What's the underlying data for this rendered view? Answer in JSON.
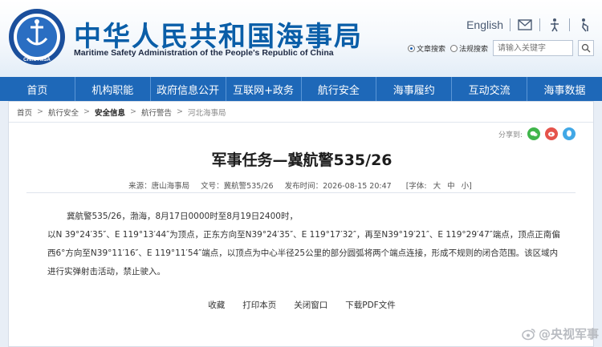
{
  "header": {
    "cn_title": "中华人民共和国海事局",
    "en_title": "Maritime Safety Administration of the People's Republic of China",
    "logo_text": "CHINA MSA",
    "english_link": "English",
    "icons": [
      "mail-icon",
      "accessibility-icon",
      "elderly-mode-icon"
    ],
    "radio_site": "文章搜索",
    "radio_law": "法规搜索",
    "search_placeholder": "请输入关键字"
  },
  "nav": {
    "items": [
      "首页",
      "机构职能",
      "政府信息公开",
      "互联网+政务",
      "航行安全",
      "海事履约",
      "互动交流",
      "海事数据"
    ]
  },
  "breadcrumb": {
    "items": [
      "首页",
      "航行安全",
      "安全信息",
      "航行警告",
      "河北海事局"
    ]
  },
  "share": {
    "label": "分享到:",
    "icons": [
      "wechat-icon",
      "weibo-icon",
      "qq-icon"
    ]
  },
  "article": {
    "title": "军事任务—冀航警535/26",
    "source": "来源：唐山海事局",
    "doc_no": "文号：冀航警535/26",
    "publish_time": "发布时间：2026-08-15 20:47",
    "font_label": "[字体:",
    "font_large": "大",
    "font_medium": "中",
    "font_small": "小]",
    "para1": "冀航警535/26，渤海，8月17日0000时至8月19日2400时，",
    "para2": "以N 39°24′35″、E 119°13′44″为顶点，正东方向至N39°24′35″、E 119°17′32″，再至N39°19′21″、E 119°29′47″端点，顶点正南偏西6°方向至N39°11′16″、E 119°11′54″端点，以顶点为中心半径25公里的部分圆弧将两个端点连接，形成不规则的闭合范围。该区域内进行实弹射击活动，禁止驶入。"
  },
  "actions": {
    "favorite": "收藏",
    "print": "打印本页",
    "close": "关闭窗口",
    "pdf": "下载PDF文件"
  },
  "watermark": {
    "text": "@央视军事"
  },
  "colors": {
    "nav_bg": "#1e68b8",
    "title_blue": "#0a5ea8",
    "page_bg": "#e8eef6"
  }
}
